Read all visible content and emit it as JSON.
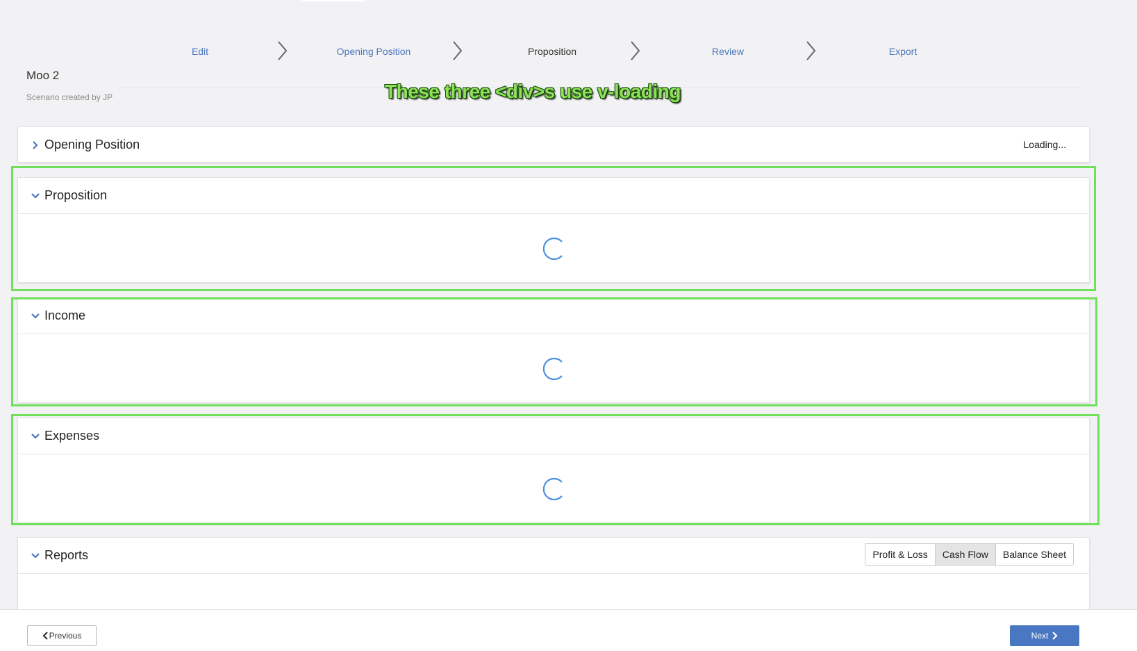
{
  "wizard": {
    "steps": [
      {
        "label": "Edit",
        "state": "link"
      },
      {
        "label": "Opening Position",
        "state": "link"
      },
      {
        "label": "Proposition",
        "state": "current"
      },
      {
        "label": "Review",
        "state": "link"
      },
      {
        "label": "Export",
        "state": "link"
      }
    ]
  },
  "scenario": {
    "title": "Moo 2",
    "subtitle": "Scenario created by JP"
  },
  "annotation": {
    "text": "These three <div>s use v-loading",
    "color": "#8ee05a"
  },
  "panels": {
    "opening_position": {
      "title": "Opening Position",
      "status": "Loading...",
      "expanded": false
    },
    "proposition": {
      "title": "Proposition",
      "expanded": true,
      "loading": true
    },
    "income": {
      "title": "Income",
      "expanded": true,
      "loading": true
    },
    "expenses": {
      "title": "Expenses",
      "expanded": true,
      "loading": true
    },
    "reports": {
      "title": "Reports",
      "expanded": true,
      "tabs": [
        {
          "label": "Profit & Loss",
          "active": false
        },
        {
          "label": "Cash Flow",
          "active": true
        },
        {
          "label": "Balance Sheet",
          "active": false
        }
      ]
    }
  },
  "footer": {
    "previous_label": "Previous",
    "next_label": "Next"
  },
  "colors": {
    "link": "#4a77bd",
    "primary_button": "#4a77c2",
    "highlight": "#6ee05a",
    "spinner": "#4a90e2"
  }
}
